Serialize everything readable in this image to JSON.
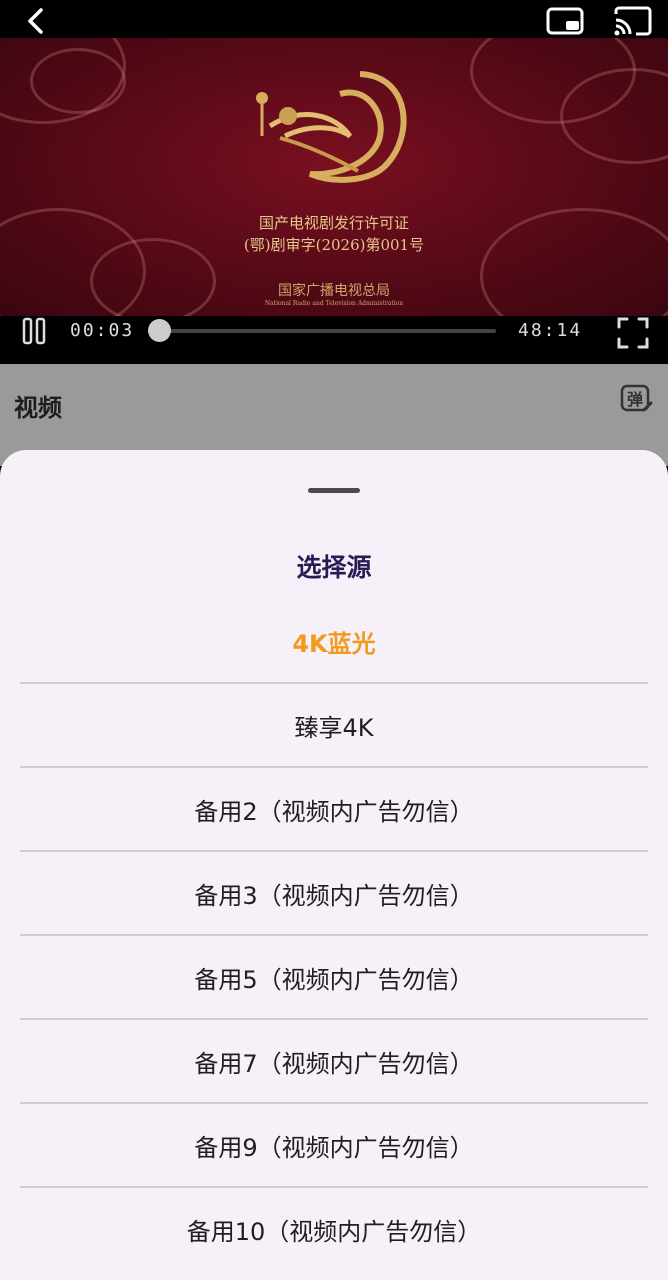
{
  "video": {
    "license_line1": "国产电视剧发行许可证",
    "license_line2": "(鄂)剧审字(2026)第001号",
    "authority_cn": "国家广播电视总局",
    "authority_en": "National Radio and Television Administration",
    "current_time": "00:03",
    "total_time": "48:14",
    "progress": 0.0
  },
  "page": {
    "title": "视频",
    "danmu_icon": "弹"
  },
  "sheet": {
    "title": "选择源",
    "items": [
      {
        "label": "4K蓝光",
        "selected": true
      },
      {
        "label": "臻享4K",
        "selected": false
      },
      {
        "label": "备用2（视频内广告勿信）",
        "selected": false
      },
      {
        "label": "备用3（视频内广告勿信）",
        "selected": false
      },
      {
        "label": "备用5（视频内广告勿信）",
        "selected": false
      },
      {
        "label": "备用7（视频内广告勿信）",
        "selected": false
      },
      {
        "label": "备用9（视频内广告勿信）",
        "selected": false
      },
      {
        "label": "备用10（视频内广告勿信）",
        "selected": false
      }
    ]
  },
  "icons": [
    "back-icon",
    "pip-icon",
    "cast-icon",
    "pause-icon",
    "fullscreen-icon",
    "danmu-icon"
  ],
  "colors": {
    "selected": "#f39a1e",
    "sheet_bg": "#f6f0f8",
    "title": "#2c1a55"
  }
}
